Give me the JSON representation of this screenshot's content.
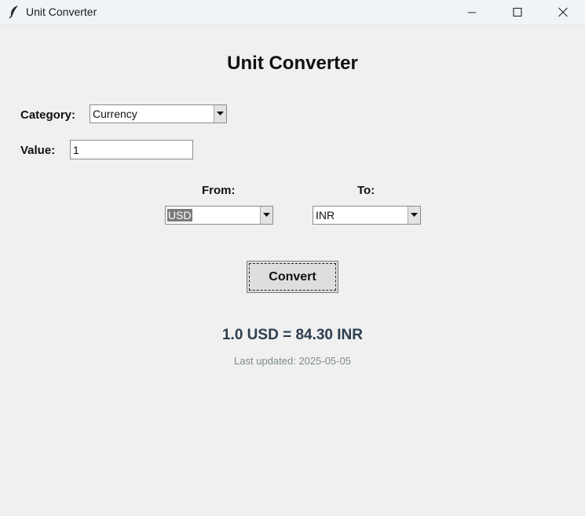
{
  "window": {
    "title": "Unit Converter",
    "icon": "feather-icon"
  },
  "heading": "Unit Converter",
  "category": {
    "label": "Category:",
    "value": "Currency"
  },
  "value_field": {
    "label": "Value:",
    "value": "1"
  },
  "from": {
    "label": "From:",
    "value": "USD"
  },
  "to": {
    "label": "To:",
    "value": "INR"
  },
  "convert_button": "Convert",
  "result": "1.0 USD = 84.30 INR",
  "last_updated": "Last updated: 2025-05-05",
  "colors": {
    "result_text": "#2c3e50",
    "muted_text": "#7f8c8d",
    "background": "#f0f0f0"
  }
}
